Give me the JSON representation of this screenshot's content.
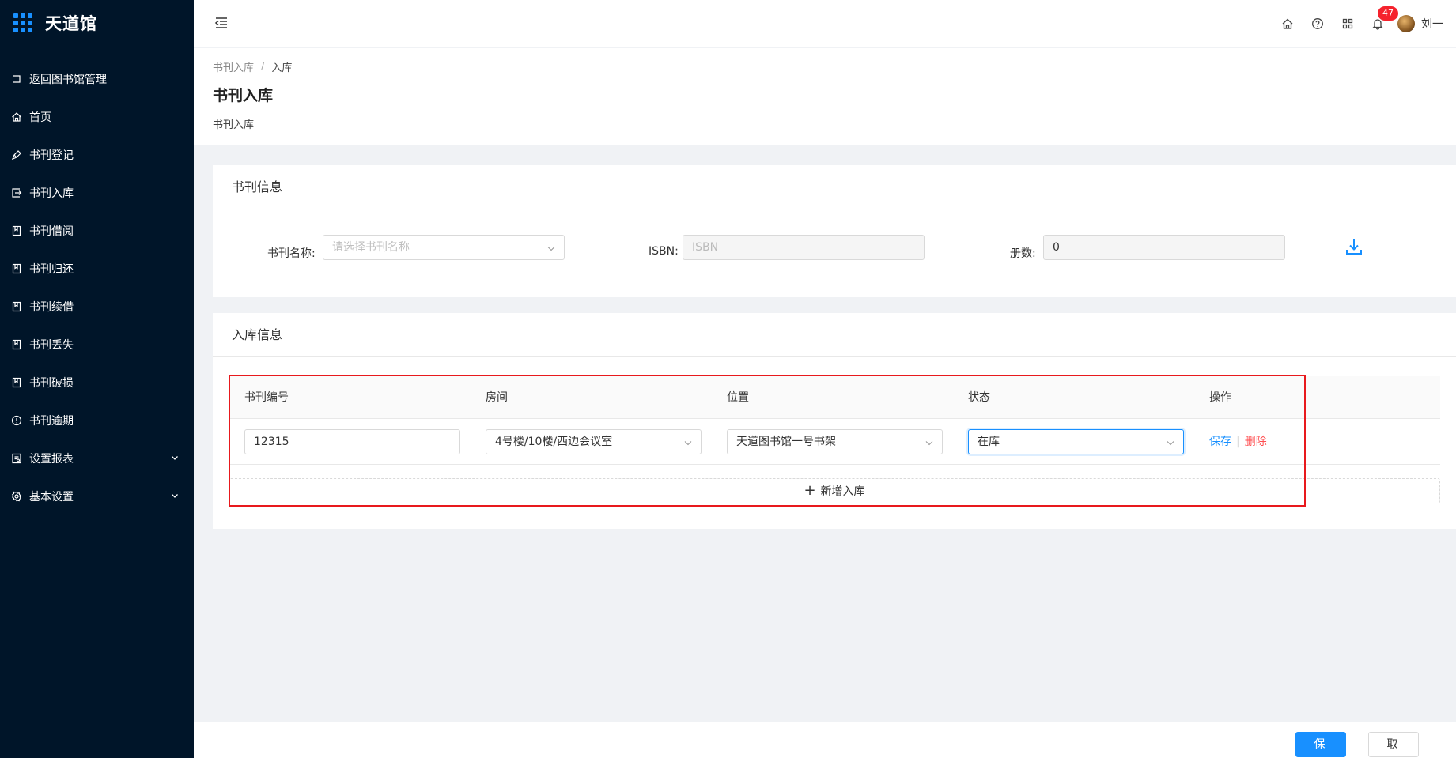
{
  "app": {
    "name": "天道馆"
  },
  "sidebar": {
    "items": [
      {
        "label": "返回图书馆管理",
        "icon": "back-icon"
      },
      {
        "label": "首页",
        "icon": "home-icon"
      },
      {
        "label": "书刊登记",
        "icon": "pen-icon"
      },
      {
        "label": "书刊入库",
        "icon": "import-icon"
      },
      {
        "label": "书刊借阅",
        "icon": "book-icon"
      },
      {
        "label": "书刊归还",
        "icon": "book-icon"
      },
      {
        "label": "书刊续借",
        "icon": "book-icon"
      },
      {
        "label": "书刊丢失",
        "icon": "book-icon"
      },
      {
        "label": "书刊破损",
        "icon": "book-icon"
      },
      {
        "label": "书刊逾期",
        "icon": "info-circle-icon"
      },
      {
        "label": "设置报表",
        "icon": "report-icon"
      },
      {
        "label": "基本设置",
        "icon": "gear-icon"
      }
    ]
  },
  "header": {
    "notification_count": "47",
    "user_name": "刘一"
  },
  "breadcrumb": {
    "parent": "书刊入库",
    "separator": "/",
    "current": "入库"
  },
  "page": {
    "title": "书刊入库",
    "subtitle": "书刊入库"
  },
  "book_info": {
    "title": "书刊信息",
    "name_label": "书刊名称:",
    "name_placeholder": "请选择书刊名称",
    "isbn_label": "ISBN:",
    "isbn_placeholder": "ISBN",
    "count_label": "册数:",
    "count_value": "0"
  },
  "stock_info": {
    "title": "入库信息",
    "columns": [
      "书刊编号",
      "房间",
      "位置",
      "状态",
      "操作"
    ],
    "rows": [
      {
        "code": "12315",
        "room": "4号楼/10楼/西边会议室",
        "location": "天道图书馆一号书架",
        "status": "在库",
        "save": "保存",
        "delete": "删除"
      }
    ],
    "add_label": "新增入库"
  },
  "footer": {
    "save_label": "保存",
    "cancel_label": "取消"
  },
  "colors": {
    "sidebar_bg": "#001529",
    "primary": "#1890ff",
    "danger": "#ff4d4f",
    "highlight": "#e8191d"
  }
}
